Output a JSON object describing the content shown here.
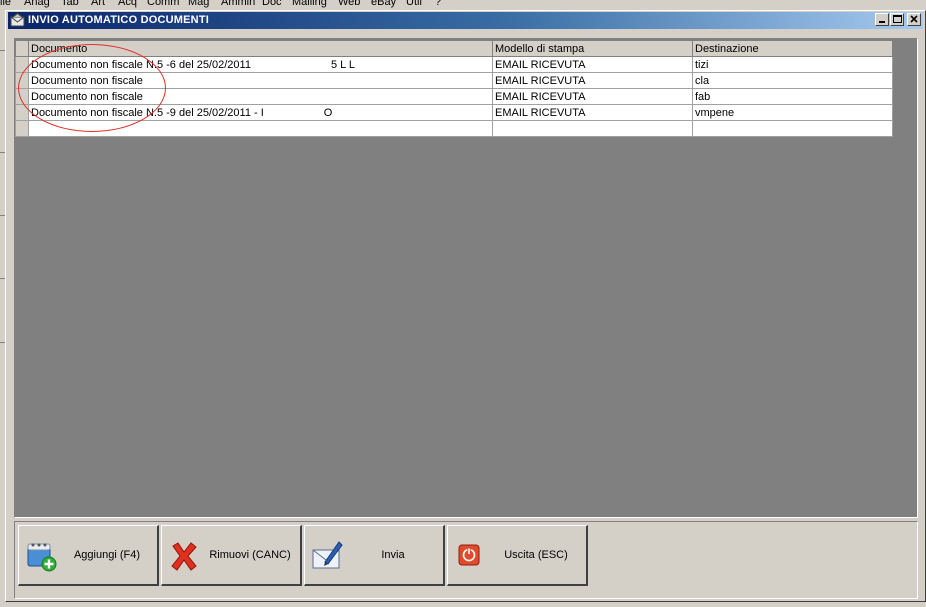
{
  "menubar": {
    "items": [
      "ile",
      "Anag",
      "Tab",
      "Art",
      "Acq",
      "Comm",
      "Mag",
      "Ammin",
      "Doc",
      "Mailing",
      "Web",
      "eBay",
      "Util",
      "?"
    ]
  },
  "window": {
    "title": "INVIO AUTOMATICO DOCUMENTI",
    "buttons": {
      "minimize": "minimize",
      "maximize": "maximize",
      "close": "close"
    }
  },
  "grid": {
    "columns": [
      "Documento",
      "Modello di stampa",
      "Destinazione"
    ],
    "rows": [
      {
        "documento": "Documento non fiscale N.5 -6 del 25/02/2011",
        "documento_tail": "5 L L",
        "modello": "EMAIL RICEVUTA",
        "destinazione": "tizi"
      },
      {
        "documento": "Documento non fiscale",
        "documento_tail": "",
        "modello": "EMAIL RICEVUTA",
        "destinazione": "cla"
      },
      {
        "documento": "Documento non fiscale",
        "documento_tail": "",
        "modello": "EMAIL RICEVUTA",
        "destinazione": "fab"
      },
      {
        "documento": "Documento non fiscale N.5 -9 del 25/02/2011 - I",
        "documento_tail": "O",
        "modello": "EMAIL RICEVUTA",
        "destinazione": "vmpene"
      }
    ]
  },
  "toolbar": {
    "add_label": "Aggiungi (F4)",
    "remove_label": "Rimuovi (CANC)",
    "send_label": "Invia",
    "exit_label": "Uscita (ESC)"
  },
  "colors": {
    "title_start": "#0a246a",
    "title_end": "#a6caf0",
    "annotation": "#e0302a",
    "grid_bg": "#808080"
  }
}
